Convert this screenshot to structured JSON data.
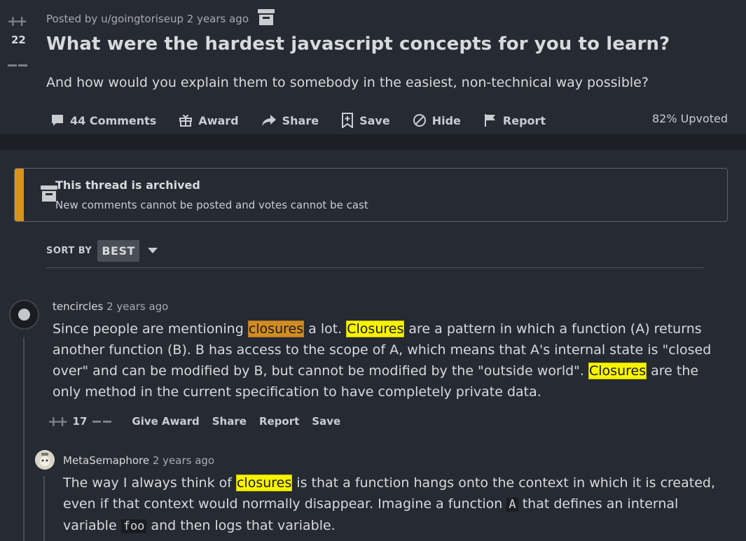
{
  "post": {
    "vote_count": "22",
    "posted_by": "Posted by u/goingtoriseup 2 years ago",
    "title": "What were the hardest javascript concepts for you to learn?",
    "body": "And how would you explain them to somebody in the easiest, non-technical way possible?",
    "actions": {
      "comments": "44 Comments",
      "award": "Award",
      "share": "Share",
      "save": "Save",
      "hide": "Hide",
      "report": "Report"
    },
    "upvoted": "82% Upvoted"
  },
  "archive_banner": {
    "title": "This thread is archived",
    "subtitle": "New comments cannot be posted and votes cannot be cast"
  },
  "sort": {
    "label": "SORT BY",
    "value": "BEST"
  },
  "comments": [
    {
      "user": "tencircles",
      "time": "2 years ago",
      "lines": [
        [
          "Since people are mentioning ",
          "closures",
          " a lot. ",
          "Closures",
          " are a pattern in which a function (A) returns"
        ],
        [
          "another function (B). B has access to the scope of A, which means that A's internal state is \"closed"
        ],
        [
          "over\" and can be modified by B, but cannot be modified by the \"outside world\". ",
          "Closures",
          " are the"
        ],
        [
          "only method in the current specification to have completely private data."
        ]
      ],
      "score": "17",
      "actions": {
        "give_award": "Give Award",
        "share": "Share",
        "report": "Report",
        "save": "Save"
      }
    },
    {
      "user": "MetaSemaphore",
      "time": "2 years ago",
      "lines": [
        [
          "The way I always think of ",
          "closures",
          " is that a function hangs onto the context in which it is created,"
        ],
        [
          "even if that context would normally disappear. Imagine a function ",
          "A",
          " that defines an internal"
        ],
        [
          "variable ",
          "foo",
          " and then logs that variable."
        ]
      ]
    }
  ],
  "colors": {
    "background": "#262a33",
    "archive_stripe": "#d8941a",
    "highlight_active": "#d18c22",
    "highlight": "#f7f300"
  }
}
